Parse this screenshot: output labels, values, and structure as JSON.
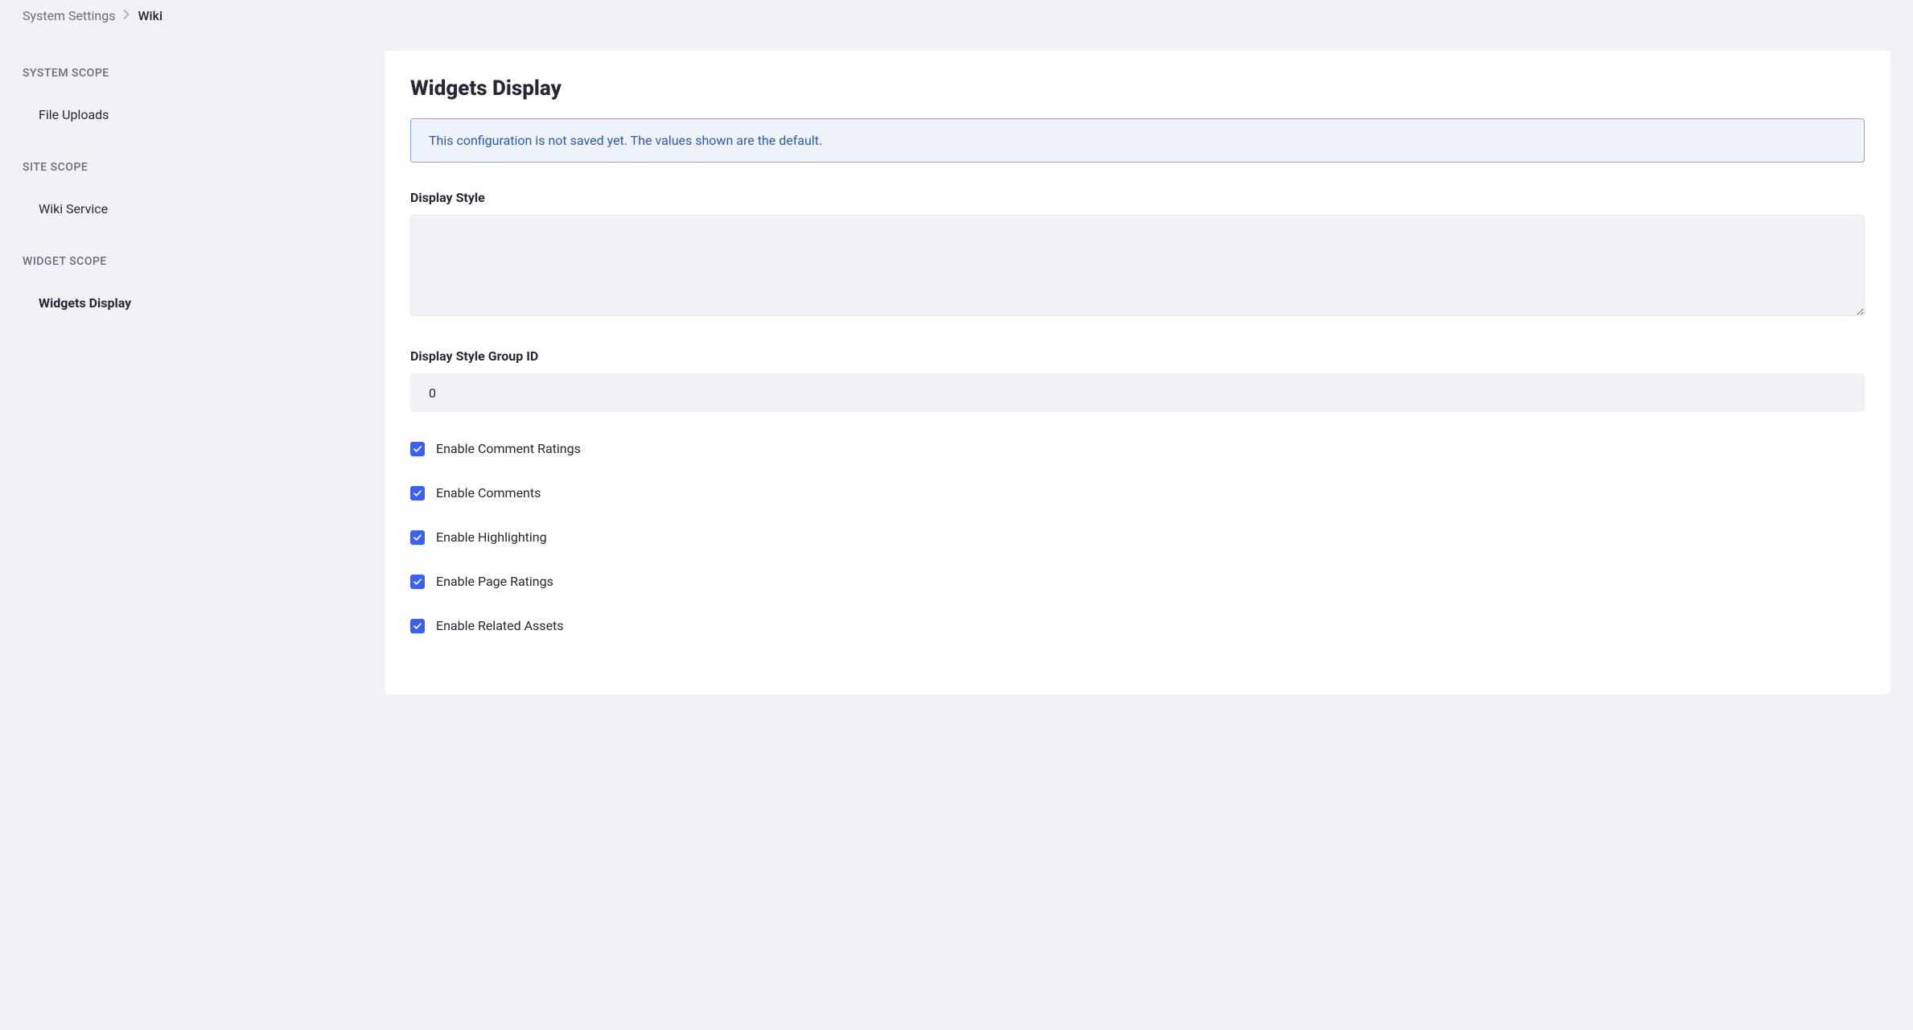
{
  "breadcrumb": {
    "parent": "System Settings",
    "current": "Wiki"
  },
  "sidebar": {
    "scopes": [
      {
        "heading": "SYSTEM SCOPE",
        "items": [
          {
            "label": "File Uploads",
            "active": false
          }
        ]
      },
      {
        "heading": "SITE SCOPE",
        "items": [
          {
            "label": "Wiki Service",
            "active": false
          }
        ]
      },
      {
        "heading": "WIDGET SCOPE",
        "items": [
          {
            "label": "Widgets Display",
            "active": true
          }
        ]
      }
    ]
  },
  "panel": {
    "title": "Widgets Display",
    "banner": "This configuration is not saved yet. The values shown are the default.",
    "fields": {
      "displayStyle": {
        "label": "Display Style",
        "value": ""
      },
      "displayStyleGroupId": {
        "label": "Display Style Group ID",
        "value": "0"
      }
    },
    "checkboxes": [
      {
        "label": "Enable Comment Ratings",
        "checked": true
      },
      {
        "label": "Enable Comments",
        "checked": true
      },
      {
        "label": "Enable Highlighting",
        "checked": true
      },
      {
        "label": "Enable Page Ratings",
        "checked": true
      },
      {
        "label": "Enable Related Assets",
        "checked": true
      }
    ]
  }
}
